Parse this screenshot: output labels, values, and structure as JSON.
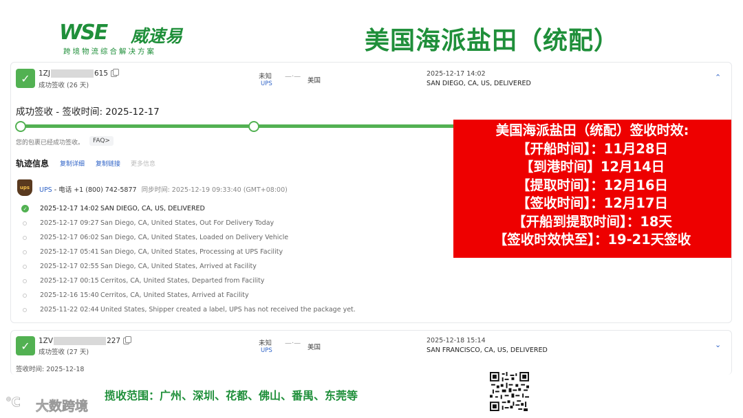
{
  "brand": {
    "logo_text": "WSE",
    "logo_cn": "威速易",
    "tagline": "跨境物流综合解决方案"
  },
  "page_title": "美国海派盐田（统配）",
  "shipment1": {
    "tracking_prefix": "1ZJ",
    "tracking_suffix": "615",
    "status": "成功签收 (26 天)",
    "origin": "未知",
    "carrier": "UPS",
    "destination": "美国",
    "latest_time": "2025-12-17 14:02",
    "latest_location": "SAN DIEGO, CA, US, DELIVERED",
    "headline": "成功签收 - 签收时间: 2025-12-17",
    "note": "您的包裹已经成功签收。",
    "faq": "FAQ>",
    "section_title": "轨迹信息",
    "links": [
      "复制详细",
      "复制链接"
    ],
    "link_disabled": "更多信息",
    "ups_logo": "ups",
    "ups_contact_carrier": "UPS",
    "ups_contact_phone": "- 电话 +1 (800) 742-5877",
    "ups_sync": "同步时间: 2025-12-19 09:33:40 (GMT+08:00)",
    "events": [
      {
        "time": "2025-12-17 14:02",
        "desc": "SAN DIEGO, CA, US, DELIVERED"
      },
      {
        "time": "2025-12-17 09:27",
        "desc": "San Diego, CA, United States, Out For Delivery Today"
      },
      {
        "time": "2025-12-17 06:02",
        "desc": "San Diego, CA, United States, Loaded on Delivery Vehicle"
      },
      {
        "time": "2025-12-17 05:41",
        "desc": "San Diego, CA, United States, Processing at UPS Facility"
      },
      {
        "time": "2025-12-17 02:55",
        "desc": "San Diego, CA, United States, Arrived at Facility"
      },
      {
        "time": "2025-12-17 00:15",
        "desc": "Cerritos, CA, United States, Departed from Facility"
      },
      {
        "time": "2025-12-16 15:40",
        "desc": "Cerritos, CA, United States, Arrived at Facility"
      },
      {
        "time": "2025-11-22 02:44",
        "desc": "United States, Shipper created a label, UPS has not received the package yet."
      }
    ]
  },
  "shipment2": {
    "tracking_prefix": "1ZV",
    "tracking_suffix": "227",
    "status": "成功签收 (27 天)",
    "origin": "未知",
    "carrier": "UPS",
    "destination": "美国",
    "latest_time": "2025-12-18 15:14",
    "latest_location": "SAN FRANCISCO, CA, US, DELIVERED",
    "sign_time": "签收时间: 2025-12-18"
  },
  "summary_box": {
    "lines": [
      "美国海派盐田（统配）签收时效:",
      "【开船时间】：11月28日",
      "【到港时间】12月14日",
      "【提取时间】：12月16日",
      "【签收时间】：12月17日",
      "【开船到提取时间】：18天",
      "【签收时效快至】：19-21天签收"
    ]
  },
  "pickup_range": "揽收范围：广州、深圳、花都、佛山、番禺、东莞等",
  "watermark": "大数跨境",
  "colors": {
    "brand_green": "#1f8f3a",
    "status_green": "#52b152",
    "link_blue": "#2f63c7",
    "highlight_red": "#ee0000"
  }
}
